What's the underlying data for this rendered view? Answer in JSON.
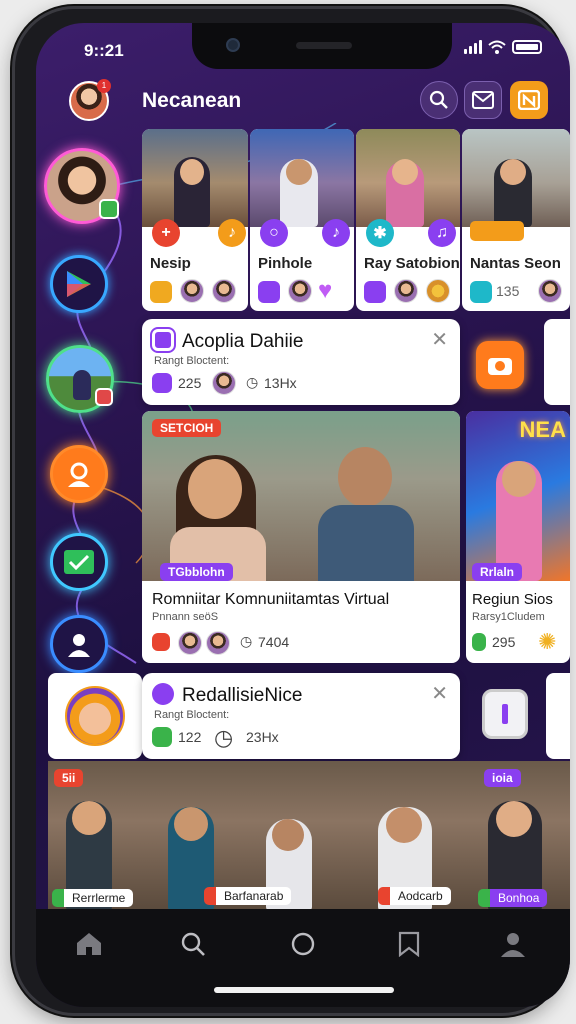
{
  "status": {
    "time": "9::21"
  },
  "header": {
    "title": "Necanean",
    "notification_count": "1"
  },
  "stories": [
    {
      "name": "Nesip"
    },
    {
      "name": "Pinhole"
    },
    {
      "name": "Ray Satobion"
    },
    {
      "name": "Nantas Seon",
      "count": "135"
    }
  ],
  "notif1": {
    "title": "Acoplia Dahiie",
    "sub": "Rangt Bloctent:",
    "count_a": "225",
    "count_b": "13Hx"
  },
  "feature": {
    "tag": "SETCIOH",
    "badge": "TGbblohn",
    "title": "Romniitar  Komnuniitamtas Virtual",
    "sub": "Pnnann seöS",
    "stat": "7404"
  },
  "side_card": {
    "banner": "NEA",
    "badge": "Rrlaln",
    "title": "Regiun Sios",
    "sub": "Rarsy1Cludem",
    "count": "295"
  },
  "notif2": {
    "title": "RedallisieNice",
    "sub": "Rangt Bloctent:",
    "count_a": "122",
    "count_b": "23Hx"
  },
  "bottom_strip": {
    "tag_left": "5ii",
    "tag_right": "ioia",
    "labels": [
      "Rerrlerme",
      "Barfanarab",
      "Aodcarb",
      "Bonhoa"
    ]
  },
  "colors": {
    "accent": "#8a3ff0",
    "orange": "#f39c1a",
    "bg": "#2a1450"
  },
  "icons": [
    "search-icon",
    "mail-icon",
    "news-icon",
    "home-icon",
    "search-nav-icon",
    "circle-icon",
    "bookmark-icon",
    "profile-icon"
  ]
}
